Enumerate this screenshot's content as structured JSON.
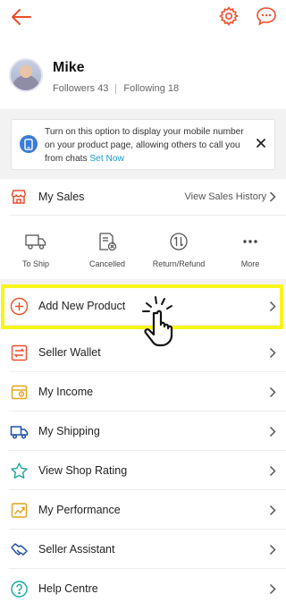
{
  "header": {
    "back_icon": "arrow-left-icon",
    "settings_icon": "gear-icon",
    "chat_icon": "chat-bubble-icon",
    "accent": "#ee4d2d"
  },
  "profile": {
    "name": "Mike",
    "followers": "Followers 43",
    "following": "Following 18"
  },
  "notice": {
    "text": "Turn on this option to display your mobile number on your product page, allowing others to call you from chats ",
    "link": "Set Now",
    "link_color": "#1a9bd8"
  },
  "sales": {
    "label": "My Sales",
    "history": "View Sales History",
    "statuses": [
      {
        "label": "To Ship",
        "icon": "truck-icon"
      },
      {
        "label": "Cancelled",
        "icon": "cancelled-doc-icon"
      },
      {
        "label": "Return/Refund",
        "icon": "refund-icon"
      },
      {
        "label": "More",
        "icon": "more-dots-icon"
      }
    ]
  },
  "menu": [
    {
      "label": "Add New Product",
      "icon": "plus-circle-icon"
    },
    {
      "label": "Seller Wallet",
      "icon": "wallet-icon"
    },
    {
      "label": "My Income",
      "icon": "income-icon"
    },
    {
      "label": "My Shipping",
      "icon": "shipping-truck-icon"
    },
    {
      "label": "View Shop Rating",
      "icon": "star-icon"
    },
    {
      "label": "My Performance",
      "icon": "performance-chart-icon"
    },
    {
      "label": "Seller Assistant",
      "icon": "handshake-icon"
    },
    {
      "label": "Help Centre",
      "icon": "help-icon"
    }
  ],
  "overlay": {
    "highlight_color": "#f7f51a",
    "pointer": "tap-hand-icon"
  }
}
